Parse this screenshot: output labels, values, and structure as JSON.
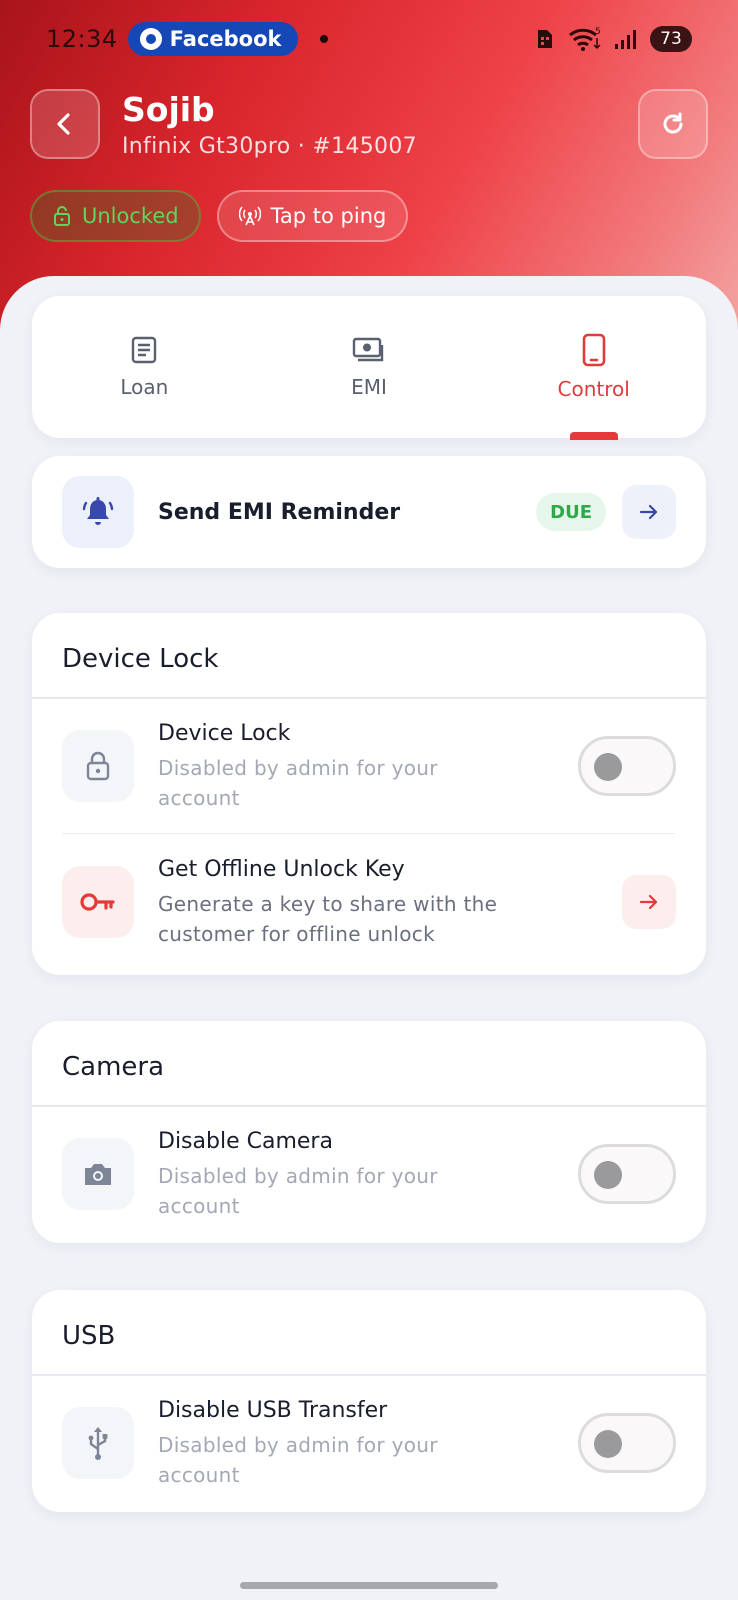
{
  "status_bar": {
    "time": "12:34",
    "notification_app": "Facebook",
    "battery": "73",
    "signal_superscript": "5"
  },
  "header": {
    "name": "Sojib",
    "device": "Infinix  Gt30pro · #145007",
    "status_pill": "Unlocked",
    "ping_pill": "Tap to ping"
  },
  "tabs": [
    {
      "label": "Loan",
      "icon": "document-icon"
    },
    {
      "label": "EMI",
      "icon": "cash-icon"
    },
    {
      "label": "Control",
      "icon": "phone-icon",
      "active": true
    }
  ],
  "reminder": {
    "label": "Send EMI Reminder",
    "badge": "DUE"
  },
  "device_lock": {
    "section_title": "Device Lock",
    "lock_title": "Device Lock",
    "lock_desc_1": "Disabled by admin for your",
    "lock_desc_2": "account",
    "key_title": "Get Offline Unlock Key",
    "key_desc_1": "Generate a key to share with the",
    "key_desc_2": "customer for offline unlock"
  },
  "camera": {
    "section_title": "Camera",
    "title": "Disable Camera",
    "desc_1": "Disabled by admin for your",
    "desc_2": "account"
  },
  "usb": {
    "section_title": "USB",
    "title": "Disable USB Transfer",
    "desc_1": "Disabled by admin for your",
    "desc_2": "account"
  },
  "colors": {
    "accent_red": "#e5393a",
    "due_green": "#2ea84a",
    "unlocked_green": "#5cd65c",
    "reminder_blue": "#3949ab"
  }
}
